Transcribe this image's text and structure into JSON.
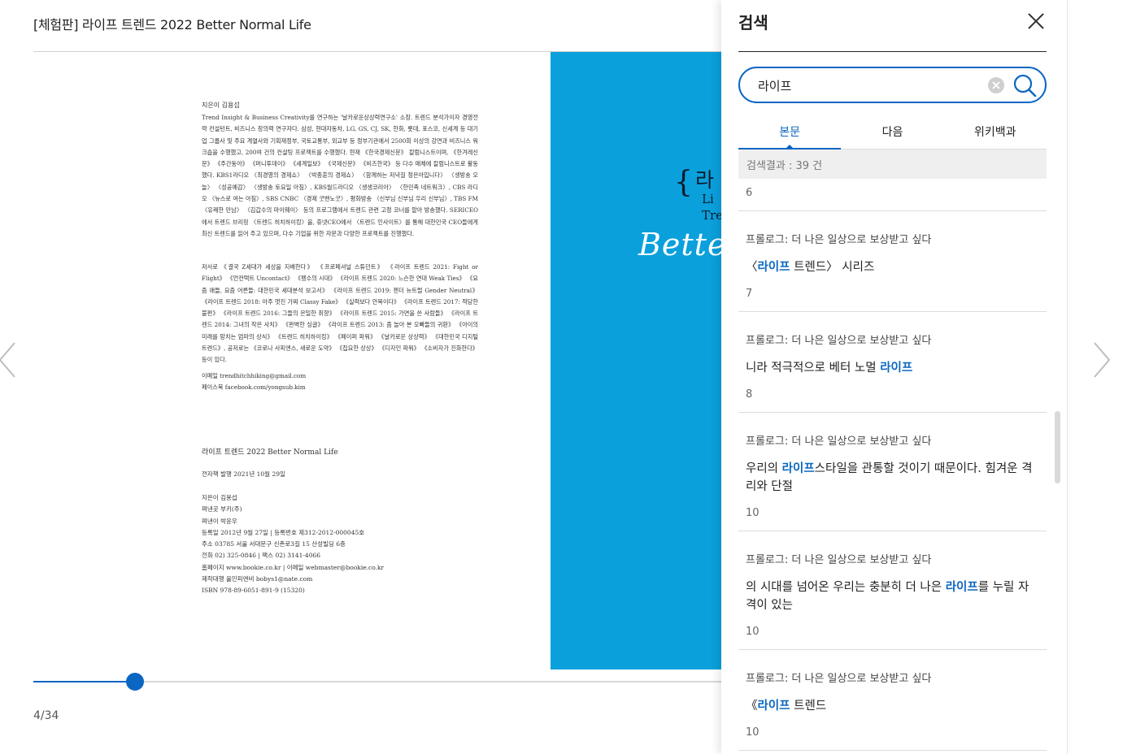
{
  "book": {
    "title": "[체험판] 라이프 트렌드 2022 Better Normal Life"
  },
  "left_page": {
    "author_heading": "지은이 김용섭",
    "author_bio": "Trend Insight & Business Creativity를 연구하는 '날카로운상상력연구소' 소장. 트렌드 분석가이자 경영전략 컨설턴트, 비즈니스 창의력 연구자다. 삼성, 현대자동차, LG, GS, CJ, SK, 한화, 롯데, 포스코, 신세계 등 대기업 그룹사 및 주요 계열사와 기획재정부, 국토교통부, 외교부 등 정부기관에서 2500회 이상의 강연과 비즈니스 워크숍을 수행했고, 200여 건의 컨설팅 프로젝트를 수행했다. 현재 《한국경제신문》 칼럼니스트이며, 《한겨레신문》 《주간동아》 《머니투데이》 《세계일보》 《국제신문》 《비즈한국》 등 다수 매체에 칼럼니스트로 활동했다. KBS1라디오 〈최경영의 경제쇼〉 〈박종훈의 경제쇼〉 〈함께하는 저녁길 정은아입니다〉 〈생방송 오늘〉 〈성공예감〉 〈생방송 토요일 아침〉, KBS월드라디오 〈생생코리아〉 〈한민족 네트워크〉, CBS 라디오 〈뉴스로 여는 아침〉, SBS CNBC 〈경제 굿밴노굿〉, 평화방송 〈신부님 신부님 우리 신부님〉, TBS FM 〈유쾌한 만남〉 〈김갑수의 마이웨이〉 등의 프로그램에서 트렌드 관련 고정 코너를 맡아 방송했다. SERICEO에서 트렌드 브리핑 〈트렌드 히치하이킹〉을, 휴넷CEO에서 〈트렌드 인사이트〉를 통해 대한민국 CEO들에게 최신 트렌드를 읽어 주고 있으며, 다수 기업을 위한 자문과 다양한 프로젝트를 진행했다.",
    "works": "저서로 《결국 Z세대가 세상을 지배한다》 《프로페셔널 스튜던트》 《라이프 트렌드 2021: Fight or Flight》 《언컨택트 Uncontact》 《펭수의 시대》 《라이프 트렌드 2020: 느슨한 연대 Weak Ties》 《요즘 애들, 요즘 어른들: 대한민국 세대분석 보고서》 《라이프 트렌드 2019: 젠더 뉴트럴 Gender Neutral》 《라이프 트렌드 2018: 아주 멋진 가짜 Classy Fake》 《실력보다 안목이다》 《라이프 트렌드 2017: 적당한 불편》 《라이프 트렌드 2016: 그들의 은밀한 취향》 《라이프 트렌드 2015: 가면을 쓴 사람들》 《라이프 트렌드 2014: 그녀의 작은 사치》 《완벽한 싱글》 《라이프 트렌드 2013: 좀 놀아 본 오빠들의 귀환》 《아이의 미래를 망치는 엄마의 상식》 《트렌드 히치하이킹》 《페이퍼 파워》 《날카로운 상상력》 《대한민국 디지털 트렌드》, 공저로는 《코로나 사피엔스, 새로운 도약》 《집요한 상상》 《디자인 파워》 《소비자가 진화한다》 등이 있다.",
    "email": "이메일 trendhitchhiking@gmail.com",
    "facebook": "페이스북 facebook.com/yongsub.kim",
    "colophon_title": "라이프 트렌드 2022 Better Normal Life",
    "colophon_date": "전자책 발행 2021년 10월 29일",
    "colophon_lines": [
      "지은이 김용섭",
      "펴낸곳 부키(주)",
      "펴낸이 박윤우",
      "등록일 2012년 9월 27일 | 등록번호 제312-2012-000045호",
      "주소 03785 서울 서대문구 신촌로3길 15 산성빌딩 6층",
      "전화 02) 325-0846 | 팩스 02) 3141-4066",
      "홈페이지 www.bookie.co.kr | 이메일 webmaster@bookie.co.kr",
      "제작대행 올인피앤비 bobys1@nate.com",
      "ISBN 978-89-6051-891-9 (15320)"
    ]
  },
  "cover": {
    "brace": "{",
    "word1": "라",
    "word2": "Li",
    "word3": "Tre",
    "better": "Better N",
    "bg_color": "#0aa0dc"
  },
  "slider": {
    "progress": 0.147,
    "accent": "#0a66c2"
  },
  "page_indicator": "4/34",
  "search_panel": {
    "title": "검색",
    "close_icon": "close-icon",
    "query": "라이프",
    "clear_icon": "clear-icon",
    "search_icon": "search-icon",
    "tabs": [
      {
        "label": "본문",
        "active": true
      },
      {
        "label": "다음",
        "active": false
      },
      {
        "label": "위키백과",
        "active": false
      }
    ],
    "result_count": "검색결과 : 39 건",
    "first_page": "6",
    "results": [
      {
        "chapter": "프롤로그: 더 나은 일상으로 보상받고 싶다",
        "before": "〈",
        "highlight": "라이프",
        "after": " 트렌드〉 시리즈",
        "page": "7"
      },
      {
        "chapter": "프롤로그: 더 나은 일상으로 보상받고 싶다",
        "before": "니라 적극적으로 베터 노멀 ",
        "highlight": "라이프",
        "after": "",
        "page": "8"
      },
      {
        "chapter": "프롤로그: 더 나은 일상으로 보상받고 싶다",
        "before": "우리의 ",
        "highlight": "라이프",
        "after": "스타일을 관통할 것이기 때문이다. 힘겨운 격리와 단절",
        "page": "10"
      },
      {
        "chapter": "프롤로그: 더 나은 일상으로 보상받고 싶다",
        "before": "의 시대를 넘어온 우리는 충분히 더 나은 ",
        "highlight": "라이프",
        "after": "를 누릴 자격이 있는",
        "page": "10"
      },
      {
        "chapter": "프롤로그: 더 나은 일상으로 보상받고 싶다",
        "before": "《",
        "highlight": "라이프",
        "after": " 트렌드",
        "page": "10"
      }
    ]
  }
}
